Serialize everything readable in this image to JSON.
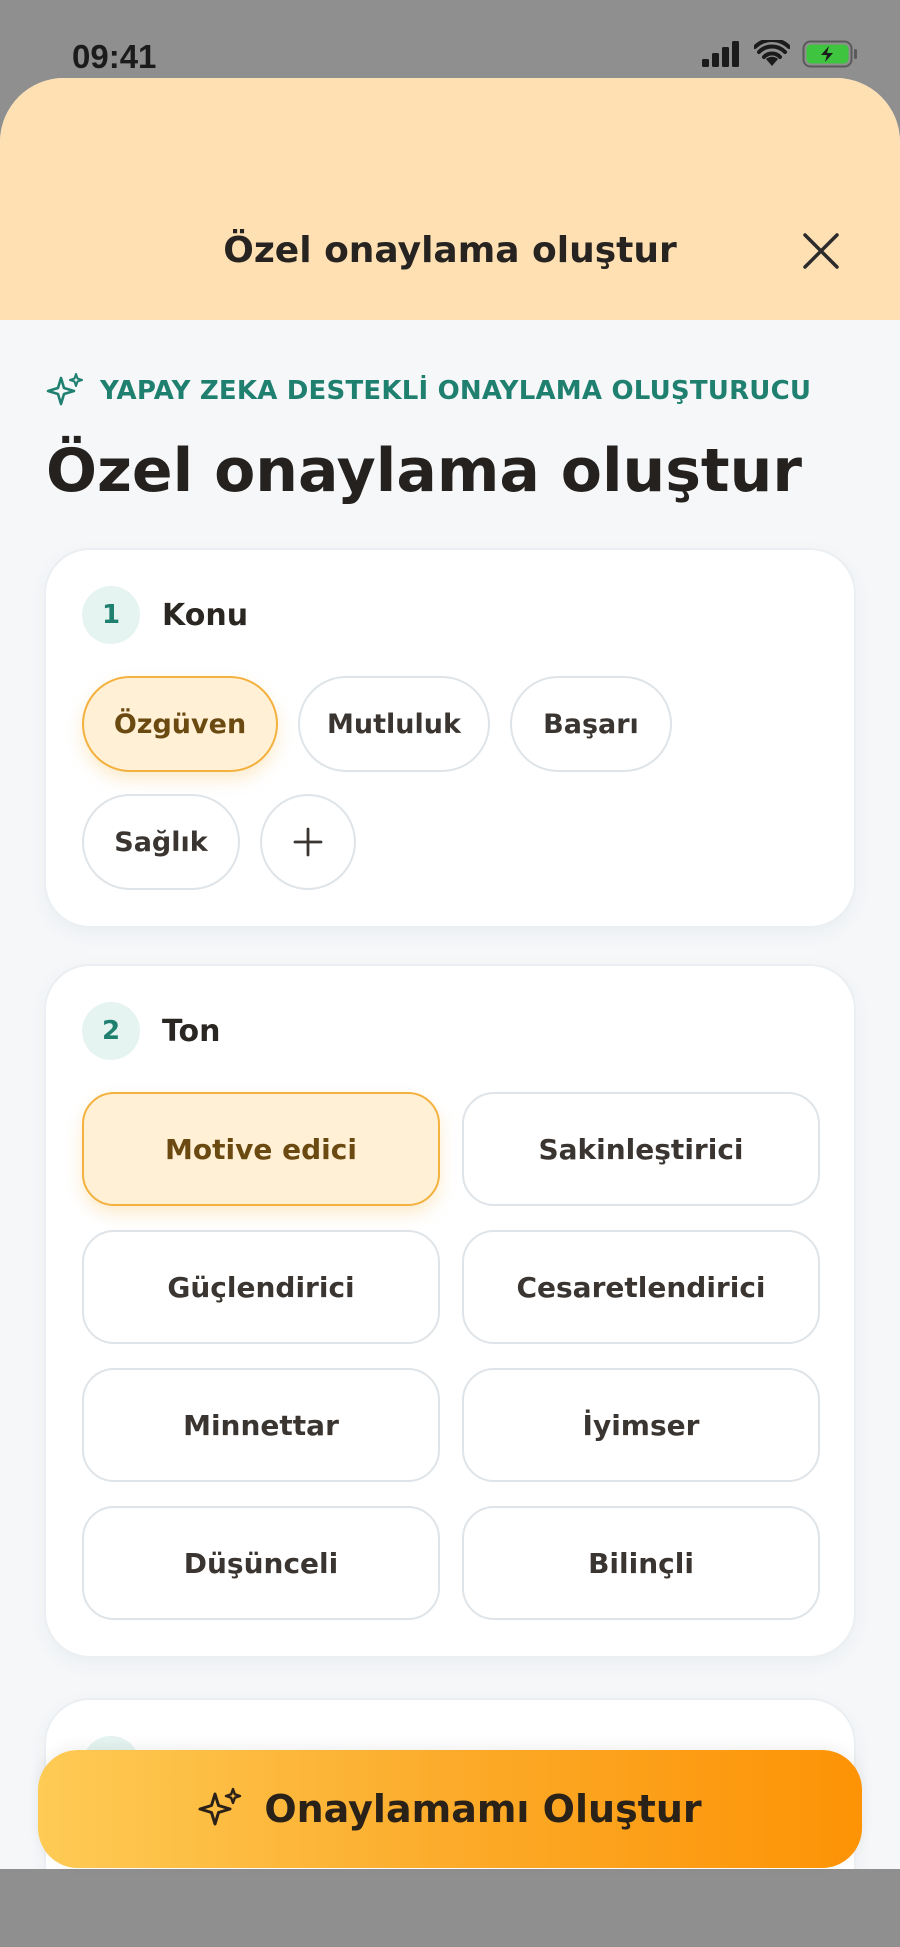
{
  "status": {
    "time": "09:41"
  },
  "header": {
    "title": "Özel onaylama oluştur"
  },
  "ai_tag": {
    "label": "YAPAY ZEKA DESTEKLİ ONAYLAMA OLUŞTURUCU"
  },
  "page": {
    "title": "Özel onaylama oluştur"
  },
  "topic": {
    "step": "1",
    "label": "Konu",
    "options": [
      "Özgüven",
      "Mutluluk",
      "Başarı",
      "Sağlık"
    ],
    "selected": "Özgüven"
  },
  "tone": {
    "step": "2",
    "label": "Ton",
    "options": [
      "Motive edici",
      "Sakinleştirici",
      "Güçlendirici",
      "Cesaretlendirici",
      "Minnettar",
      "İyimser",
      "Düşünceli",
      "Bilinçli"
    ],
    "selected": "Motive edici"
  },
  "cta": {
    "label": "Onaylamamı Oluştur"
  },
  "colors": {
    "accent": "#fcab2a",
    "teal": "#1f8070",
    "header_bg": "#fee0b3"
  },
  "icons": {
    "close": "close-icon",
    "sparkle": "sparkle-icon",
    "add": "plus-icon"
  }
}
